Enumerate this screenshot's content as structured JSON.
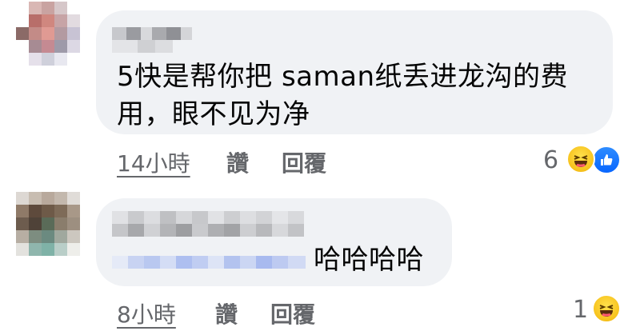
{
  "comments": [
    {
      "text_line1": "5快是帮你把 saman纸丢进龙沟的费",
      "text_line2": "用，眼不见为净",
      "time": "14小時",
      "like_label": "讚",
      "reply_label": "回覆",
      "reaction_count": "6",
      "reaction_icons": [
        "haha-icon",
        "like-icon"
      ]
    },
    {
      "text": "哈哈哈哈",
      "time": "8小時",
      "like_label": "讚",
      "reply_label": "回覆",
      "reaction_count": "1",
      "reaction_icons": [
        "haha-icon"
      ]
    }
  ],
  "colors": {
    "bubble": "#f0f2f5",
    "meta_text": "#65676b",
    "like_blue": "#0866ff",
    "haha_yellow": "#f7c21c"
  }
}
